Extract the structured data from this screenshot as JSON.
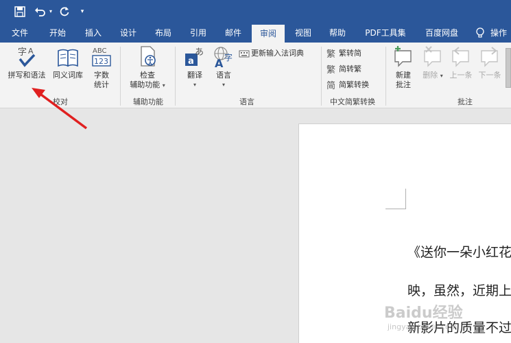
{
  "quick_access": {
    "save_icon": "save-icon",
    "undo_icon": "undo-icon",
    "redo_icon": "redo-icon",
    "customize_icon": "customize-icon"
  },
  "tabs": [
    {
      "label": "文件"
    },
    {
      "label": "开始"
    },
    {
      "label": "插入"
    },
    {
      "label": "设计"
    },
    {
      "label": "布局"
    },
    {
      "label": "引用"
    },
    {
      "label": "邮件"
    },
    {
      "label": "审阅",
      "active": true
    },
    {
      "label": "视图"
    },
    {
      "label": "帮助"
    },
    {
      "label": "PDF工具集"
    },
    {
      "label": "百度网盘"
    },
    {
      "label": "操作"
    }
  ],
  "ribbon": {
    "proofing": {
      "label": "校对",
      "spelling": "拼写和语法",
      "thesaurus": "同义词库",
      "word_count_1": "字数",
      "word_count_2": "统计"
    },
    "accessibility": {
      "label": "辅助功能",
      "check_1": "检查",
      "check_2": "辅助功能"
    },
    "language": {
      "label": "语言",
      "translate": "翻译",
      "language": "语言",
      "update_ime": "更新输入法词典"
    },
    "chinese_conversion": {
      "label": "中文简繁转换",
      "to_simplified": "繁转简",
      "to_traditional": "简转繁",
      "convert": "简繁转换"
    },
    "comments": {
      "label": "批注",
      "new_1": "新建",
      "new_2": "批注",
      "delete": "删除",
      "previous": "上一条",
      "next": "下一条"
    }
  },
  "document": {
    "line1": "《送你一朵小红花",
    "line2": "映，虽然，近期上",
    "line3": "新影片的质量不过"
  },
  "watermark": {
    "text": "Baidu经验",
    "sub": "jingyan.baidu.com"
  },
  "colors": {
    "brand": "#2b579a",
    "ribbon_bg": "#f3f3f3",
    "arrow": "#e02020"
  }
}
